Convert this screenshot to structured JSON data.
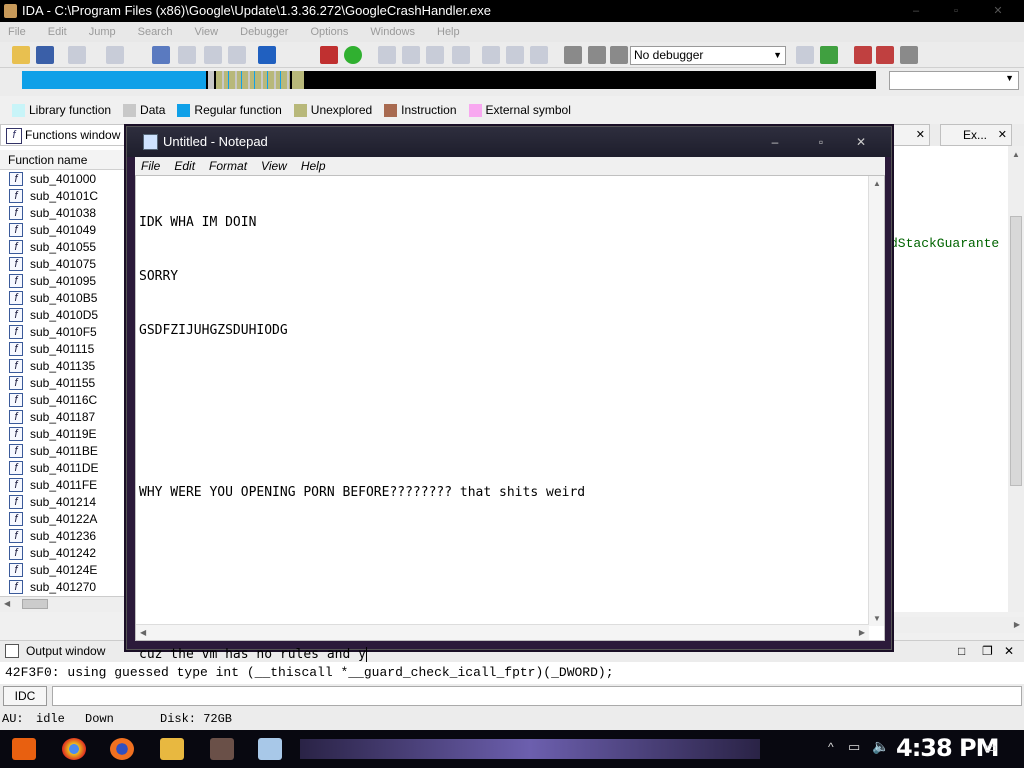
{
  "ida": {
    "title": "IDA - C:\\Program Files (x86)\\Google\\Update\\1.3.36.272\\GoogleCrashHandler.exe",
    "menu": [
      "File",
      "Edit",
      "Jump",
      "Search",
      "View",
      "Debugger",
      "Options",
      "Windows",
      "Help"
    ],
    "debugger_select": "No debugger",
    "legend": [
      {
        "label": "Library function",
        "color": "#c8f4f8"
      },
      {
        "label": "Data",
        "color": "#c8c8c8"
      },
      {
        "label": "Regular function",
        "color": "#0fa0e8"
      },
      {
        "label": "Unexplored",
        "color": "#b8b87a"
      },
      {
        "label": "Instruction",
        "color": "#a86a50"
      },
      {
        "label": "External symbol",
        "color": "#f8a8f0"
      }
    ],
    "functions_tab": "Functions window",
    "function_column": "Function name",
    "functions": [
      "sub_401000",
      "sub_40101C",
      "sub_401038",
      "sub_401049",
      "sub_401055",
      "sub_401075",
      "sub_401095",
      "sub_4010B5",
      "sub_4010D5",
      "sub_4010F5",
      "sub_401115",
      "sub_401135",
      "sub_401155",
      "sub_40116C",
      "sub_401187",
      "sub_40119E",
      "sub_4011BE",
      "sub_4011DE",
      "sub_4011FE",
      "sub_401214",
      "sub_40122A",
      "sub_401236",
      "sub_401242",
      "sub_40124E",
      "sub_401270"
    ],
    "right_tab_label": "Ex...",
    "right_code_fragment": "dStackGuarante",
    "output_title": "Output window",
    "output_line": "42F3F0: using guessed type int (__thiscall *__guard_check_icall_fptr)(_DWORD);",
    "idc_button": "IDC",
    "status": {
      "au": "AU:",
      "state": "idle",
      "direction": "Down",
      "disk": "Disk: 72GB"
    }
  },
  "notepad": {
    "title": "Untitled - Notepad",
    "menu": [
      "File",
      "Edit",
      "Format",
      "View",
      "Help"
    ],
    "lines": [
      "IDK WHA IM DOIN",
      "SORRY",
      "GSDFZIJUHGZSDUHIODG",
      "",
      "",
      "WHY WERE YOU OPENING PORN BEFORE???????? that shits weird",
      "",
      "",
      "cuz the vm has no rules and y"
    ]
  },
  "taskbar": {
    "clock": "4:38 PM"
  }
}
